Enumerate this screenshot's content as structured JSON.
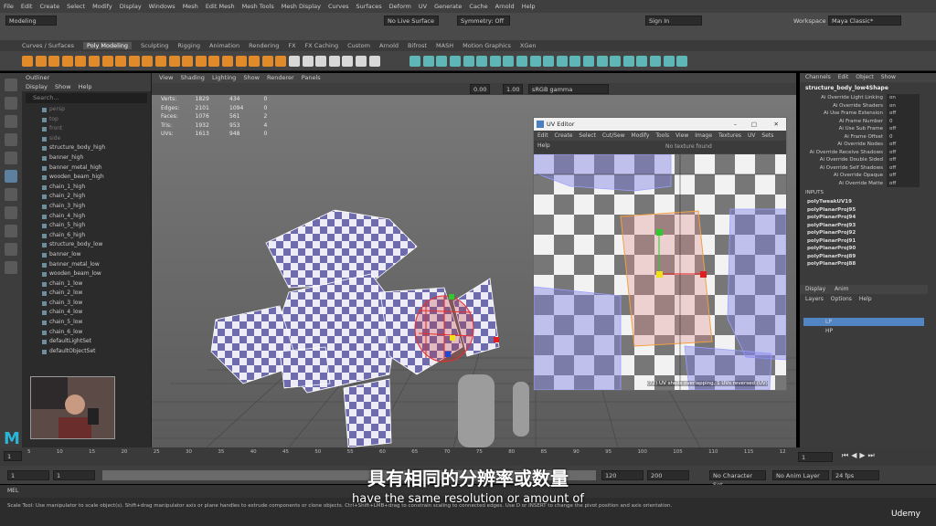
{
  "menubar": {
    "items": [
      "File",
      "Edit",
      "Create",
      "Select",
      "Modify",
      "Display",
      "Windows",
      "Mesh",
      "Edit Mesh",
      "Mesh Tools",
      "Mesh Display",
      "Curves",
      "Surfaces",
      "Deform",
      "UV",
      "Generate",
      "Cache",
      "Arnold",
      "Help"
    ],
    "workspace_label": "Workspace :",
    "workspace_value": "Maya Classic*"
  },
  "statusline": {
    "mode": "Modeling",
    "live_surface": "No Live Surface",
    "symmetry": "Symmetry: Off",
    "sign_in": "Sign In"
  },
  "shelf": {
    "tabs": [
      "Curves / Surfaces",
      "Poly Modeling",
      "Sculpting",
      "Rigging",
      "Animation",
      "Rendering",
      "FX",
      "FX Caching",
      "Custom",
      "Arnold",
      "Bifrost",
      "MASH",
      "Motion Graphics",
      "XGen"
    ],
    "active": "Poly Modeling"
  },
  "outliner": {
    "title": "Outliner",
    "menu": [
      "Display",
      "Show",
      "Help"
    ],
    "search_placeholder": "Search...",
    "items": [
      {
        "label": "persp",
        "dim": true
      },
      {
        "label": "top",
        "dim": true
      },
      {
        "label": "front",
        "dim": true
      },
      {
        "label": "side",
        "dim": true
      },
      {
        "label": "structure_body_high"
      },
      {
        "label": "banner_high"
      },
      {
        "label": "banner_metal_high"
      },
      {
        "label": "wooden_beam_high"
      },
      {
        "label": "chain_1_high"
      },
      {
        "label": "chain_2_high"
      },
      {
        "label": "chain_3_high"
      },
      {
        "label": "chain_4_high"
      },
      {
        "label": "chain_5_high"
      },
      {
        "label": "chain_6_high"
      },
      {
        "label": "structure_body_low"
      },
      {
        "label": "banner_low"
      },
      {
        "label": "banner_metal_low"
      },
      {
        "label": "wooden_beam_low"
      },
      {
        "label": "chain_1_low"
      },
      {
        "label": "chain_2_low"
      },
      {
        "label": "chain_3_low"
      },
      {
        "label": "chain_4_low"
      },
      {
        "label": "chain_5_low"
      },
      {
        "label": "chain_6_low"
      },
      {
        "label": "defaultLightSet"
      },
      {
        "label": "defaultObjectSet"
      }
    ]
  },
  "viewport": {
    "menu": [
      "View",
      "Shading",
      "Lighting",
      "Show",
      "Renderer",
      "Panels"
    ],
    "exposure": "0.00",
    "gamma": "1.00",
    "color_space": "sRGB gamma",
    "hud": [
      [
        "Verts:",
        "1829",
        "434",
        "0"
      ],
      [
        "Edges:",
        "2101",
        "1094",
        "0"
      ],
      [
        "Faces:",
        "1076",
        "561",
        "2"
      ],
      [
        "Tris:",
        "1932",
        "953",
        "4"
      ],
      [
        "UVs:",
        "1613",
        "948",
        "0"
      ]
    ]
  },
  "uv_editor": {
    "title": "UV Editor",
    "menu": [
      "Edit",
      "Create",
      "Select",
      "Cut/Sew",
      "Modify",
      "Tools",
      "View",
      "Image",
      "Textures",
      "UV Sets",
      "Help"
    ],
    "texture": "No texture found",
    "status": "(72) UV shells overlapping, 1 UVs reversed (UV)"
  },
  "channel_box": {
    "menu": [
      "Channels",
      "Edit",
      "Object",
      "Show"
    ],
    "object": "structure_body_low4Shape",
    "attrs": [
      [
        "Ai Override Light Linking",
        "on"
      ],
      [
        "Ai Override Shaders",
        "on"
      ],
      [
        "Ai Use Frame Extension",
        "off"
      ],
      [
        "Ai Frame Number",
        "0"
      ],
      [
        "Ai Use Sub Frame",
        "off"
      ],
      [
        "Ai Frame Offset",
        "0"
      ],
      [
        "Ai Override Nodes",
        "off"
      ],
      [
        "Ai Override Receive Shadows",
        "off"
      ],
      [
        "Ai Override Double Sided",
        "off"
      ],
      [
        "Ai Override Self Shadows",
        "off"
      ],
      [
        "Ai Override Opaque",
        "off"
      ],
      [
        "Ai Override Matte",
        "off"
      ]
    ],
    "inputs_label": "INPUTS",
    "inputs": [
      "polyTweakUV19",
      "polyPlanarProj95",
      "polyPlanarProj94",
      "polyPlanarProj93",
      "polyPlanarProj92",
      "polyPlanarProj91",
      "polyPlanarProj90",
      "polyPlanarProj89",
      "polyPlanarProj88"
    ],
    "layer_tabs": [
      "Display",
      "Anim"
    ],
    "layer_menu": [
      "Layers",
      "Options",
      "Help"
    ],
    "layers": [
      "LP",
      "HP"
    ]
  },
  "timeline": {
    "ticks": [
      "5",
      "10",
      "15",
      "20",
      "25",
      "30",
      "35",
      "40",
      "45",
      "50",
      "55",
      "60",
      "65",
      "70",
      "75",
      "80",
      "85",
      "90",
      "95",
      "100",
      "105",
      "110",
      "115",
      "12"
    ],
    "current": "1"
  },
  "range": {
    "start": "1",
    "start2": "1",
    "end": "120",
    "end2": "120",
    "max": "200",
    "char_set": "No Character Set",
    "anim_layer": "No Anim Layer",
    "fps": "24 fps"
  },
  "mel": {
    "label": "MEL"
  },
  "help_line": "Scale Tool: Use manipulator to scale object(s). Shift+drag manipulator axis or plane handles to extrude components or clone objects. Ctrl+Shift+LMB+drag to constrain scaling to connected edges. Use D or INSERT to change the pivot position and axis orientation.",
  "subtitle": {
    "cn": "具有相同的分辨率或数量",
    "en": "have the same resolution or amount of"
  },
  "branding": {
    "udemy": "Udemy",
    "logo": "M"
  }
}
